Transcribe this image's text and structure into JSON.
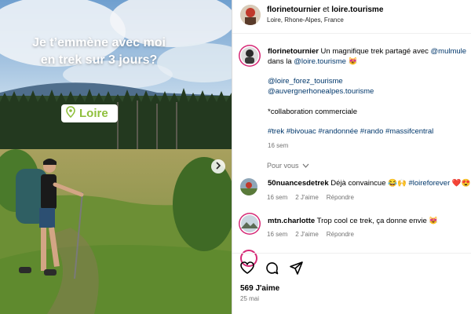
{
  "post_image": {
    "headline_line1": "Je t’emmène avec moi",
    "headline_line2": "en trek sur 3 jours?",
    "badge_label": "Loire",
    "badge_color": "#8fbf3c"
  },
  "header": {
    "author": "florinetournier",
    "connector": "et",
    "coauthor": "loire.tourisme",
    "location": "Loire, Rhone-Alpes, France"
  },
  "caption": {
    "username": "florinetournier",
    "text_before": " Un magnifique trek partagé avec ",
    "mention1": "@mulmule",
    "line2_prefix": "dans la ",
    "mention2": "@loire.tourisme",
    "emoji": "😻",
    "tag1": "@loire_forez_tourisme",
    "tag2": "@auvergnerhonealpes.tourisme",
    "collab": "*collaboration commerciale",
    "hashtags": "#trek #bivouac #randonnée #rando #massifcentral",
    "time": "16 sem"
  },
  "pour_vous": "Pour vous",
  "comments": [
    {
      "username": "50nuancesdetrek",
      "text": " Déjà convaincue 😂🙌 ",
      "hashtag": "#loireforever",
      "suffix": " ❤️😍",
      "time": "16 sem",
      "likes": "2 J'aime",
      "reply": "Répondre"
    },
    {
      "username": "mtn.charlotte",
      "text": " Trop cool ce trek, ça donne envie 😻",
      "time": "16 sem",
      "likes": "2 J'aime",
      "reply": "Répondre"
    }
  ],
  "post_stats": {
    "likes": "569 J'aime",
    "date": "25 mai"
  },
  "icons": [
    "map-pin-icon",
    "chevron-right-icon",
    "chevron-down-icon",
    "heart-icon",
    "comment-icon",
    "share-icon"
  ],
  "colors": {
    "link": "#00376b",
    "muted": "#737373",
    "story_ring": "#d62976"
  }
}
